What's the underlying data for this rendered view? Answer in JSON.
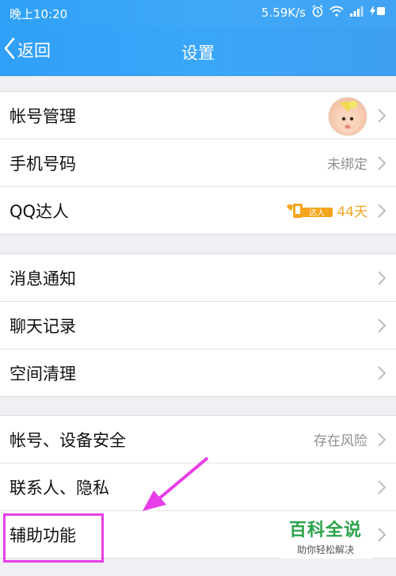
{
  "status_bar": {
    "time": "晚上10:20",
    "network_speed": "5.59K/s",
    "icons": [
      "alarm-icon",
      "wifi-icon",
      "signal-icon",
      "charging-icon"
    ]
  },
  "header": {
    "back_label": "返回",
    "title": "设置"
  },
  "groups": [
    {
      "items": [
        {
          "label": "帐号管理",
          "accessory": "avatar"
        },
        {
          "label": "手机号码",
          "value": "未绑定"
        },
        {
          "label": "QQ达人",
          "badge": "达人",
          "value": "44天"
        }
      ]
    },
    {
      "items": [
        {
          "label": "消息通知"
        },
        {
          "label": "聊天记录"
        },
        {
          "label": "空间清理"
        }
      ]
    },
    {
      "items": [
        {
          "label": "帐号、设备安全",
          "value": "存在风险"
        },
        {
          "label": "联系人、隐私"
        },
        {
          "label": "辅助功能"
        }
      ]
    }
  ],
  "watermark": {
    "title": "百科全说",
    "subtitle": "助你轻松解决"
  },
  "colors": {
    "header_blue": "#3aa6f8",
    "annotation_magenta": "#e83ee8",
    "qq_gold": "#f5a51c",
    "watermark_green": "#2aa34a"
  }
}
